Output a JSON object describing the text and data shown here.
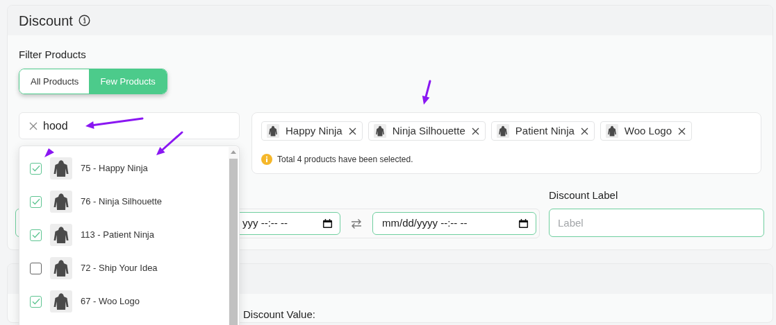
{
  "discount_card": {
    "title": "Discount",
    "filter": {
      "label": "Filter Products",
      "options": [
        {
          "label": "All Products",
          "selected": false
        },
        {
          "label": "Few Products",
          "selected": true
        }
      ]
    },
    "search": {
      "value": "hood"
    },
    "selected_products": [
      "Happy Ninja",
      "Ninja Silhouette",
      "Patient Ninja",
      "Woo Logo"
    ],
    "selection_note": "Total 4 products have been selected.",
    "date_range": {
      "start_value": "yyy --:-- --",
      "end_value": "mm/dd/yyyy --:-- --"
    },
    "discount_label": {
      "label": "Discount Label",
      "placeholder": "Label"
    }
  },
  "search_results": [
    {
      "label": "75 - Happy Ninja",
      "checked": true
    },
    {
      "label": "76 - Ninja Silhouette",
      "checked": true
    },
    {
      "label": "113 - Patient Ninja",
      "checked": true
    },
    {
      "label": "72 - Ship Your Idea",
      "checked": false
    },
    {
      "label": "67 - Woo Logo",
      "checked": true
    }
  ],
  "value_card": {
    "label": "Discount Value:"
  }
}
